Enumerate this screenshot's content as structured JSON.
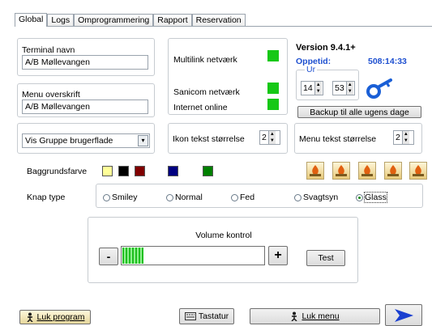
{
  "tabs": [
    "Global",
    "Logs",
    "Omprogrammering",
    "Rapport",
    "Reservation"
  ],
  "terminal": {
    "label": "Terminal navn",
    "value": "A/B Møllevangen"
  },
  "menu_header": {
    "label": "Menu overskrift",
    "value": "A/B Møllevangen"
  },
  "group_select": {
    "value": "Vis Gruppe brugerflade"
  },
  "status": {
    "multilink": "Multilink netværk",
    "sanicom": "Sanicom netværk",
    "internet": "Internet online",
    "ok_color": "#16c816"
  },
  "icon_text": {
    "label": "Ikon tekst størrelse",
    "value": "2"
  },
  "version": {
    "text": "Version 9.4.1+",
    "uptime_label": "Oppetid:",
    "uptime_value": "508:14:33",
    "clock_label": "Ur",
    "hour": "14",
    "minute": "53",
    "backup_button": "Backup til alle ugens dage"
  },
  "menu_text": {
    "label": "Menu tekst størrelse",
    "value": "2"
  },
  "background": {
    "label": "Baggrundsfarve",
    "colors": [
      "#ffff99",
      "#000000",
      "#800000",
      "#000080",
      "#008000"
    ]
  },
  "button_type": {
    "label": "Knap type",
    "options": [
      "Smiley",
      "Normal",
      "Fed",
      "Svagtsyn",
      "Glass"
    ],
    "selected": "Glass"
  },
  "volume": {
    "title": "Volume kontrol",
    "minus": "-",
    "plus": "+",
    "test": "Test",
    "level_percent": 15
  },
  "footer": {
    "close_program": "Luk program",
    "keyboard": "Tastatur",
    "close_menu": "Luk menu"
  }
}
